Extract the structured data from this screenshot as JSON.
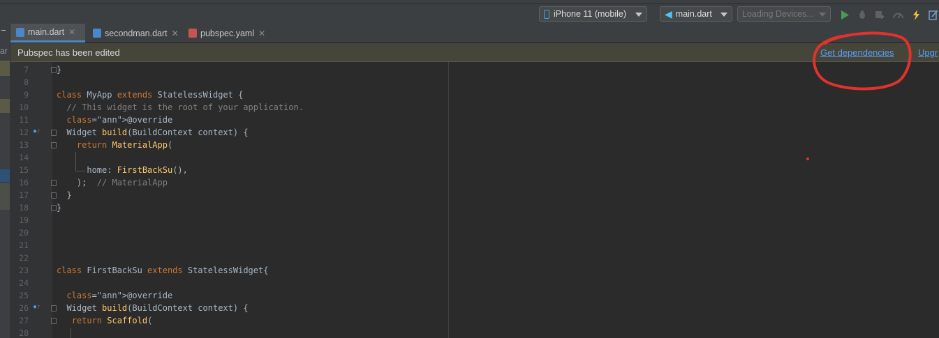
{
  "toolbar": {
    "device_selector": "iPhone 11 (mobile)",
    "run_config": "main.dart",
    "devices_status": "Loading Devices..."
  },
  "tabs": [
    {
      "label": "main.dart",
      "active": true,
      "file_icon": "dart-file-icon"
    },
    {
      "label": "secondman.dart",
      "active": false,
      "file_icon": "dart-file-icon"
    },
    {
      "label": "pubspec.yaml",
      "active": false,
      "file_icon": "yaml-file-icon"
    }
  ],
  "left_strip_fragment": "ar",
  "notification": {
    "message": "Pubspec has been edited",
    "action_primary": "Get dependencies",
    "action_secondary": "Upgr"
  },
  "code_lines": [
    {
      "n": "7",
      "text": "}"
    },
    {
      "n": "8",
      "text": ""
    },
    {
      "n": "9",
      "text": "class MyApp extends StatelessWidget {"
    },
    {
      "n": "10",
      "text": "  // This widget is the root of your application."
    },
    {
      "n": "11",
      "text": "  @override"
    },
    {
      "n": "12",
      "text": "  Widget build(BuildContext context) {"
    },
    {
      "n": "13",
      "text": "    return MaterialApp("
    },
    {
      "n": "14",
      "text": ""
    },
    {
      "n": "15",
      "text": "      home: FirstBackSu(),"
    },
    {
      "n": "16",
      "text": "    );  // MaterialApp"
    },
    {
      "n": "17",
      "text": "  }"
    },
    {
      "n": "18",
      "text": "}"
    },
    {
      "n": "19",
      "text": ""
    },
    {
      "n": "20",
      "text": ""
    },
    {
      "n": "21",
      "text": ""
    },
    {
      "n": "22",
      "text": ""
    },
    {
      "n": "23",
      "text": "class FirstBackSu extends StatelessWidget{"
    },
    {
      "n": "24",
      "text": ""
    },
    {
      "n": "25",
      "text": "  @override"
    },
    {
      "n": "26",
      "text": "  Widget build(BuildContext context) {"
    },
    {
      "n": "27",
      "text": "   return Scaffold("
    },
    {
      "n": "28",
      "text": ""
    }
  ],
  "colors": {
    "keyword": "#cc7832",
    "function": "#ffc66d",
    "annotation": "#bbb529",
    "comment": "#808080",
    "link": "#589df6",
    "annotation_circle": "#e0332b"
  }
}
